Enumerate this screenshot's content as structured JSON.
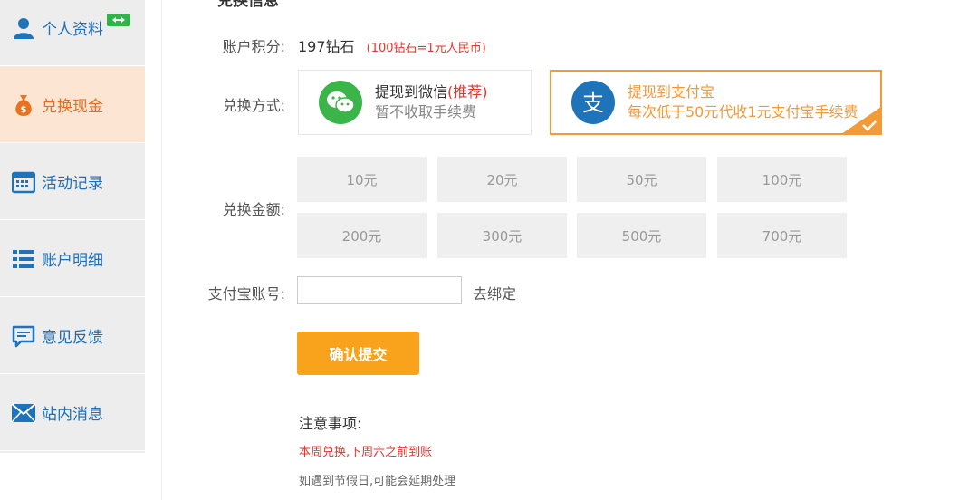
{
  "sidebar": {
    "items": [
      {
        "label": "个人资料",
        "icon": "user-icon"
      },
      {
        "label": "兑换现金",
        "icon": "money-bag-icon",
        "active": true
      },
      {
        "label": "活动记录",
        "icon": "calendar-icon"
      },
      {
        "label": "账户明细",
        "icon": "list-icon"
      },
      {
        "label": "意见反馈",
        "icon": "feedback-icon"
      },
      {
        "label": "站内消息",
        "icon": "mail-icon"
      }
    ]
  },
  "main": {
    "section_title": "兑换信息",
    "points": {
      "label": "账户积分:",
      "value": "197钻石",
      "rate": "(100钻石=1元人民币)"
    },
    "method": {
      "label": "兑换方式:",
      "options": [
        {
          "title": "提现到微信",
          "tag": "(推荐)",
          "subtitle": "暂不收取手续费",
          "icon": "wechat-icon",
          "selected": false
        },
        {
          "title": "提现到支付宝",
          "tag": "",
          "subtitle": "每次低于50元代收1元支付宝手续费",
          "icon": "alipay-icon",
          "selected": true
        }
      ]
    },
    "amount": {
      "label": "兑换金额:",
      "options": [
        "10元",
        "20元",
        "50元",
        "100元",
        "200元",
        "300元",
        "500元",
        "700元"
      ]
    },
    "account": {
      "label": "支付宝账号:",
      "value": "",
      "bind_link": "去绑定"
    },
    "submit_label": "确认提交",
    "notes": {
      "title": "注意事项:",
      "items": [
        "本周兑换,下周六之前到账",
        "如遇到节假日,可能会延期处理"
      ]
    }
  },
  "colors": {
    "accent_orange": "#f9a21b",
    "nav_blue": "#1e6fb8",
    "alert_red": "#e5352f",
    "wechat_green": "#3bb54a",
    "alipay_blue": "#1e73b9"
  }
}
